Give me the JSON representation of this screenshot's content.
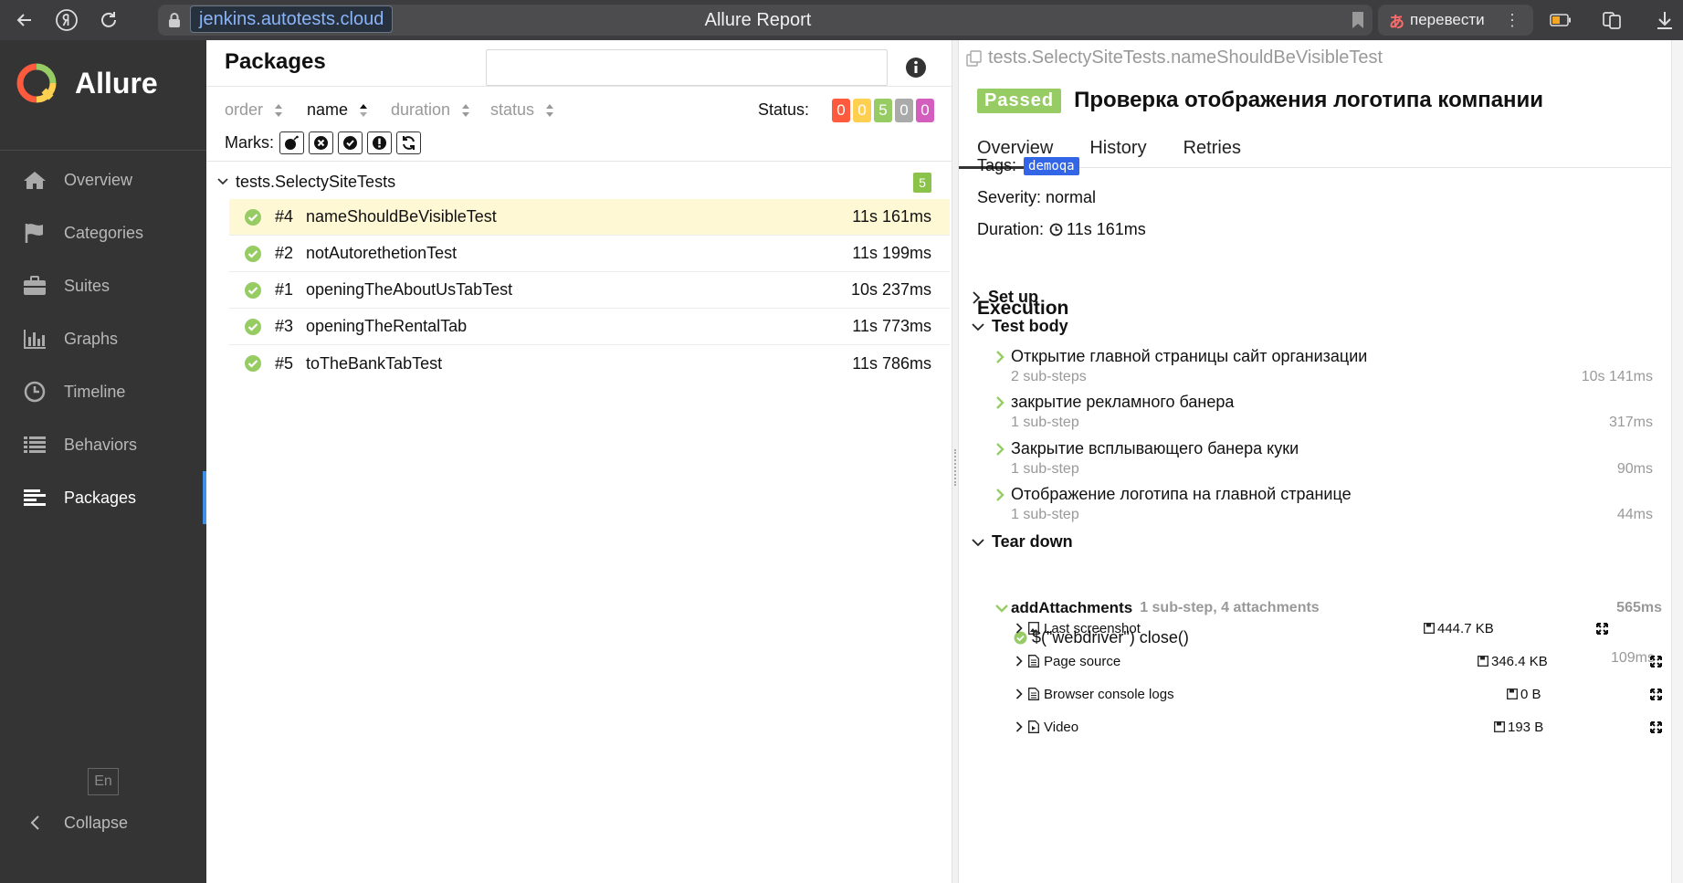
{
  "browser": {
    "url": "jenkins.autotests.cloud",
    "tab_title": "Allure Report",
    "translate_label": "перевести",
    "more_label": "⋮"
  },
  "sidebar": {
    "brand": "Allure",
    "items": [
      {
        "label": "Overview",
        "icon": "home-icon"
      },
      {
        "label": "Categories",
        "icon": "flag-icon"
      },
      {
        "label": "Suites",
        "icon": "briefcase-icon"
      },
      {
        "label": "Graphs",
        "icon": "bar-chart-icon"
      },
      {
        "label": "Timeline",
        "icon": "clock-icon"
      },
      {
        "label": "Behaviors",
        "icon": "list-icon"
      },
      {
        "label": "Packages",
        "icon": "packages-icon",
        "active": true
      }
    ],
    "language": "En",
    "collapse_label": "Collapse"
  },
  "packages": {
    "title": "Packages",
    "search_value": "",
    "sort": {
      "order": "order",
      "name": "name",
      "duration": "duration",
      "status": "status"
    },
    "status_label": "Status:",
    "status_counts": [
      {
        "value": "0",
        "color": "#fd5a3e"
      },
      {
        "value": "0",
        "color": "#ffd050"
      },
      {
        "value": "5",
        "color": "#97cc64"
      },
      {
        "value": "0",
        "color": "#aaaaaa"
      },
      {
        "value": "0",
        "color": "#d35ebe"
      }
    ],
    "marks_label": "Marks:",
    "marks": [
      "new-failed-icon",
      "new-broken-icon",
      "new-passed-icon",
      "flaky-icon",
      "retries-icon"
    ],
    "group": {
      "name": "tests.SelectySiteTests",
      "count": "5"
    },
    "rows": [
      {
        "num": "#4",
        "name": "nameShouldBeVisibleTest",
        "time": "11s 161ms",
        "selected": true
      },
      {
        "num": "#2",
        "name": "notAutorethetionTest",
        "time": "11s 199ms"
      },
      {
        "num": "#1",
        "name": "openingTheAboutUsTabTest",
        "time": "10s 237ms"
      },
      {
        "num": "#3",
        "name": "openingTheRentalTab",
        "time": "11s 773ms"
      },
      {
        "num": "#5",
        "name": "toTheBankTabTest",
        "time": "11s 786ms"
      }
    ]
  },
  "detail": {
    "breadcrumb": "tests.SelectySiteTests.nameShouldBeVisibleTest",
    "status": "Passed",
    "title": "Проверка отображения логотипа компании",
    "tabs": [
      "Overview",
      "History",
      "Retries"
    ],
    "tags_label": "Tags:",
    "tag": "demoqa",
    "severity": "Severity: normal",
    "duration_label": "Duration:",
    "duration": "11s 161ms",
    "execution": "Execution",
    "setup": "Set up",
    "test_body": "Test body",
    "steps": [
      {
        "name": "Открытие главной страницы сайт организации",
        "sub": "2 sub-steps",
        "dur": "10s 141ms"
      },
      {
        "name": "закрытие рекламного банера",
        "sub": "1 sub-step",
        "dur": "317ms"
      },
      {
        "name": "Закрытие всплывающего банера куки",
        "sub": "1 sub-step",
        "dur": "90ms"
      },
      {
        "name": "Отображение логотипа на главной странице",
        "sub": "1 sub-step",
        "dur": "44ms"
      }
    ],
    "teardown": "Tear down",
    "add_attachments": {
      "name": "addAttachments",
      "meta": "1 sub-step, 4 attachments",
      "dur": "565ms"
    },
    "webdriver": {
      "name": "$(\"webdriver\") close()",
      "dur": "109ms"
    },
    "attachments": [
      {
        "name": "Last screenshot",
        "icon": "image-file-icon",
        "size": "444.7 KB"
      },
      {
        "name": "Page source",
        "icon": "text-file-icon",
        "size": "346.4 KB"
      },
      {
        "name": "Browser console logs",
        "icon": "text-file-icon",
        "size": "0 B"
      },
      {
        "name": "Video",
        "icon": "video-file-icon",
        "size": "193 B"
      }
    ]
  }
}
